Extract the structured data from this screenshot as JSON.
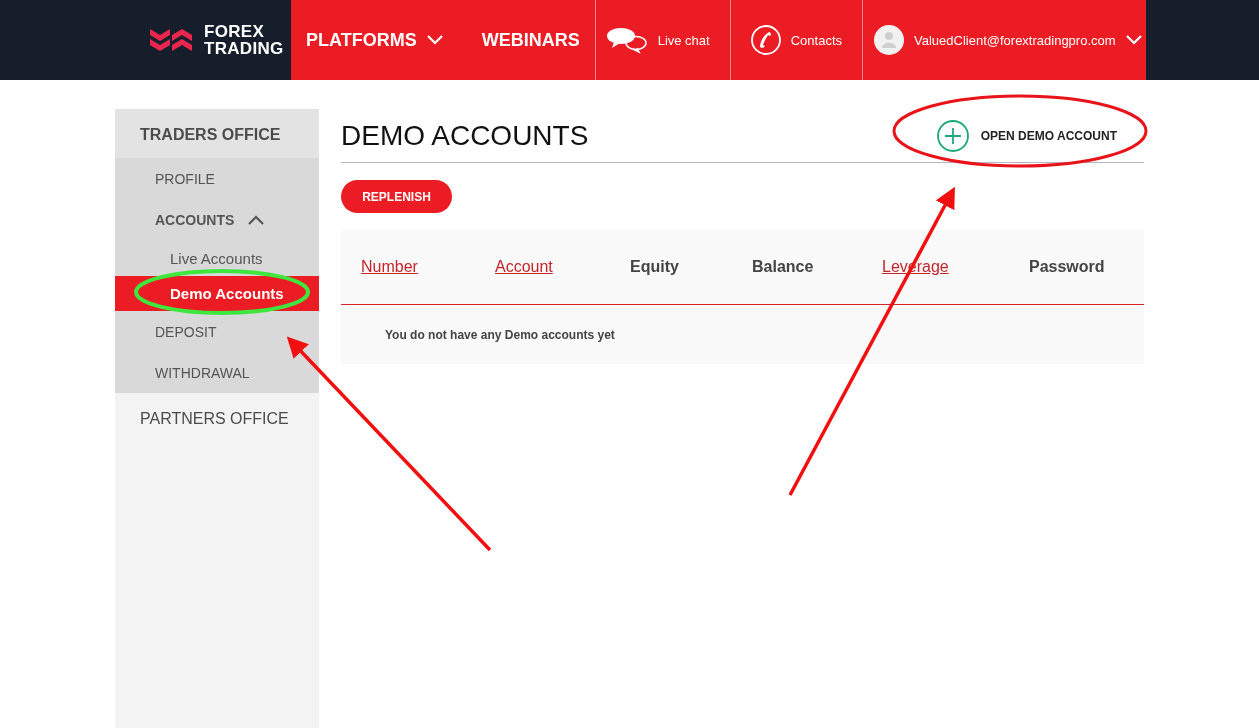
{
  "header": {
    "logo": [
      "FOREX",
      "TRADING"
    ],
    "nav": [
      {
        "label": "PLATFORMS",
        "dropdown": true
      },
      {
        "label": "WEBINARS",
        "dropdown": false
      }
    ],
    "actions": [
      {
        "kind": "chat",
        "label": "Live chat"
      },
      {
        "kind": "phone",
        "label": "Contacts"
      }
    ],
    "user": {
      "email": "ValuedClient@forextradingpro.com"
    }
  },
  "sidebar": {
    "sections": [
      {
        "title": "TRADERS OFFICE",
        "expanded": true,
        "items": [
          {
            "label": "PROFILE",
            "selected": false
          },
          {
            "label": "ACCOUNTS",
            "selected": false,
            "expanded": true,
            "children": [
              {
                "label": "Live Accounts",
                "selected": false
              },
              {
                "label": "Demo Accounts",
                "selected": true
              }
            ]
          },
          {
            "label": "DEPOSIT",
            "selected": false
          },
          {
            "label": "WITHDRAWAL",
            "selected": false
          }
        ]
      },
      {
        "title": "PARTNERS OFFICE",
        "expanded": false
      }
    ]
  },
  "main": {
    "title": "DEMO ACCOUNTS",
    "open_button": "OPEN DEMO ACCOUNT",
    "replenish_button": "REPLENISH",
    "table": {
      "columns": [
        {
          "label": "Number",
          "kind": "link"
        },
        {
          "label": "Account",
          "kind": "link"
        },
        {
          "label": "Equity",
          "kind": "plain"
        },
        {
          "label": "Balance",
          "kind": "plain"
        },
        {
          "label": "Leverage",
          "kind": "link"
        },
        {
          "label": "Password",
          "kind": "plain"
        }
      ],
      "empty_message": "You do not have any Demo accounts yet"
    }
  }
}
